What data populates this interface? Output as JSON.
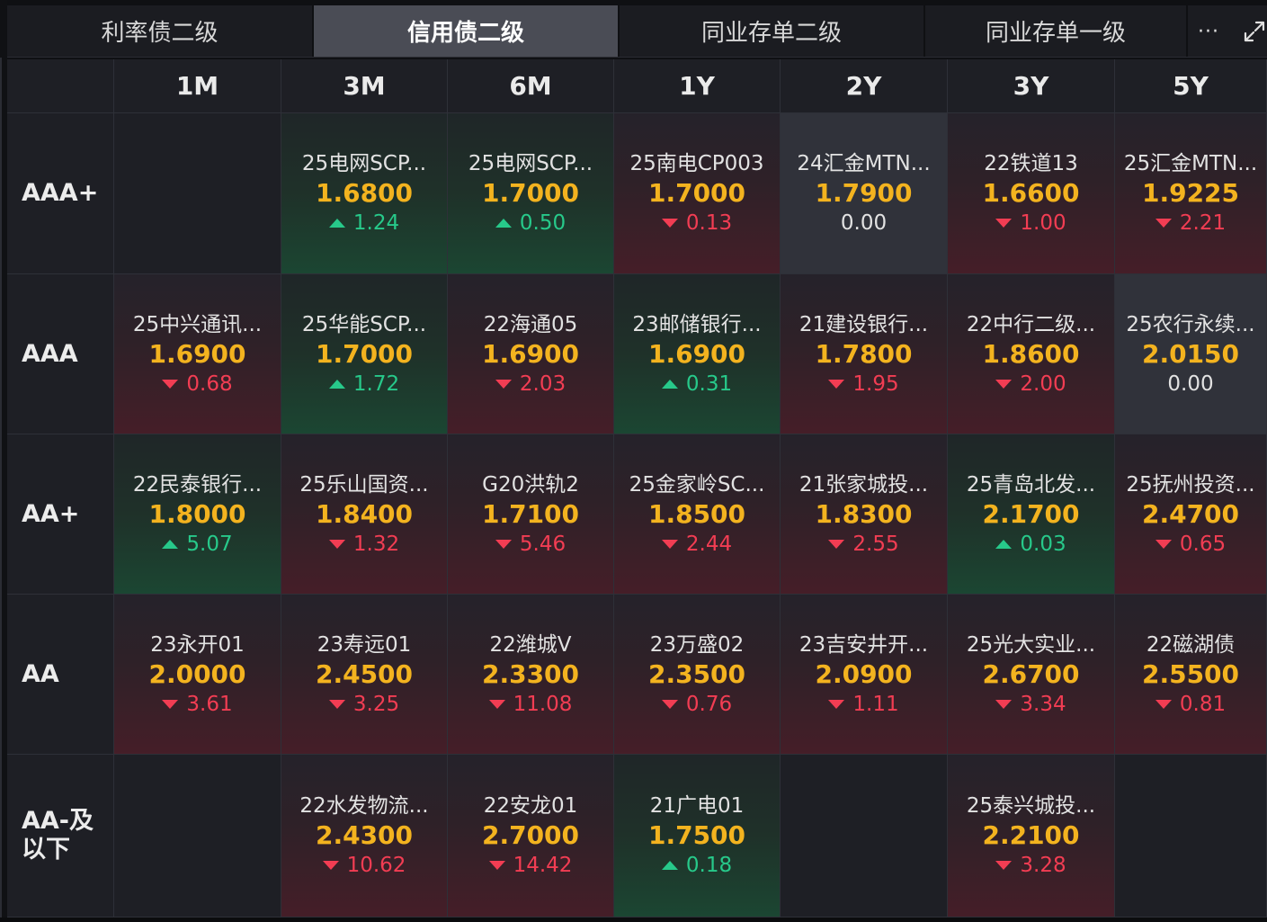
{
  "tabs": [
    {
      "label": "利率债二级",
      "active": false
    },
    {
      "label": "信用债二级",
      "active": true
    },
    {
      "label": "同业存单二级",
      "active": false
    },
    {
      "label": "同业存单一级",
      "active": false
    }
  ],
  "toolbar": {
    "more_label": "···"
  },
  "colors": {
    "up": "#27c98a",
    "down": "#f23d53",
    "yield": "#f3b31f",
    "active_tab": "#4a4c55"
  },
  "terms": [
    "1M",
    "3M",
    "6M",
    "1Y",
    "2Y",
    "3Y",
    "5Y"
  ],
  "rows": [
    {
      "rating": "AAA+",
      "cells": [
        null,
        {
          "name": "25电网SCP...",
          "yield": "1.6800",
          "change": "1.24",
          "dir": "up"
        },
        {
          "name": "25电网SCP...",
          "yield": "1.7000",
          "change": "0.50",
          "dir": "up"
        },
        {
          "name": "25南电CP003",
          "yield": "1.7000",
          "change": "0.13",
          "dir": "down"
        },
        {
          "name": "24汇金MTN...",
          "yield": "1.7900",
          "change": "0.00",
          "dir": "flat"
        },
        {
          "name": "22铁道13",
          "yield": "1.6600",
          "change": "1.00",
          "dir": "down"
        },
        {
          "name": "25汇金MTN...",
          "yield": "1.9225",
          "change": "2.21",
          "dir": "down"
        }
      ]
    },
    {
      "rating": "AAA",
      "cells": [
        {
          "name": "25中兴通讯...",
          "yield": "1.6900",
          "change": "0.68",
          "dir": "down"
        },
        {
          "name": "25华能SCP...",
          "yield": "1.7000",
          "change": "1.72",
          "dir": "up"
        },
        {
          "name": "22海通05",
          "yield": "1.6900",
          "change": "2.03",
          "dir": "down"
        },
        {
          "name": "23邮储银行...",
          "yield": "1.6900",
          "change": "0.31",
          "dir": "up"
        },
        {
          "name": "21建设银行...",
          "yield": "1.7800",
          "change": "1.95",
          "dir": "down"
        },
        {
          "name": "22中行二级...",
          "yield": "1.8600",
          "change": "2.00",
          "dir": "down"
        },
        {
          "name": "25农行永续...",
          "yield": "2.0150",
          "change": "0.00",
          "dir": "flat"
        }
      ]
    },
    {
      "rating": "AA+",
      "cells": [
        {
          "name": "22民泰银行...",
          "yield": "1.8000",
          "change": "5.07",
          "dir": "up"
        },
        {
          "name": "25乐山国资...",
          "yield": "1.8400",
          "change": "1.32",
          "dir": "down"
        },
        {
          "name": "G20洪轨2",
          "yield": "1.7100",
          "change": "5.46",
          "dir": "down"
        },
        {
          "name": "25金家岭SC...",
          "yield": "1.8500",
          "change": "2.44",
          "dir": "down"
        },
        {
          "name": "21张家城投...",
          "yield": "1.8300",
          "change": "2.55",
          "dir": "down"
        },
        {
          "name": "25青岛北发...",
          "yield": "2.1700",
          "change": "0.03",
          "dir": "up"
        },
        {
          "name": "25抚州投资...",
          "yield": "2.4700",
          "change": "0.65",
          "dir": "down"
        }
      ]
    },
    {
      "rating": "AA",
      "cells": [
        {
          "name": "23永开01",
          "yield": "2.0000",
          "change": "3.61",
          "dir": "down"
        },
        {
          "name": "23寿远01",
          "yield": "2.4500",
          "change": "3.25",
          "dir": "down"
        },
        {
          "name": "22潍城V",
          "yield": "2.3300",
          "change": "11.08",
          "dir": "down"
        },
        {
          "name": "23万盛02",
          "yield": "2.3500",
          "change": "0.76",
          "dir": "down"
        },
        {
          "name": "23吉安井开...",
          "yield": "2.0900",
          "change": "1.11",
          "dir": "down"
        },
        {
          "name": "25光大实业...",
          "yield": "2.6700",
          "change": "3.34",
          "dir": "down"
        },
        {
          "name": "22磁湖债",
          "yield": "2.5500",
          "change": "0.81",
          "dir": "down"
        }
      ]
    },
    {
      "rating": "AA-及\n以下",
      "cells": [
        null,
        {
          "name": "22水发物流...",
          "yield": "2.4300",
          "change": "10.62",
          "dir": "down"
        },
        {
          "name": "22安龙01",
          "yield": "2.7000",
          "change": "14.42",
          "dir": "down"
        },
        {
          "name": "21广电01",
          "yield": "1.7500",
          "change": "0.18",
          "dir": "up"
        },
        null,
        {
          "name": "25泰兴城投...",
          "yield": "2.2100",
          "change": "3.28",
          "dir": "down"
        },
        null
      ]
    }
  ]
}
